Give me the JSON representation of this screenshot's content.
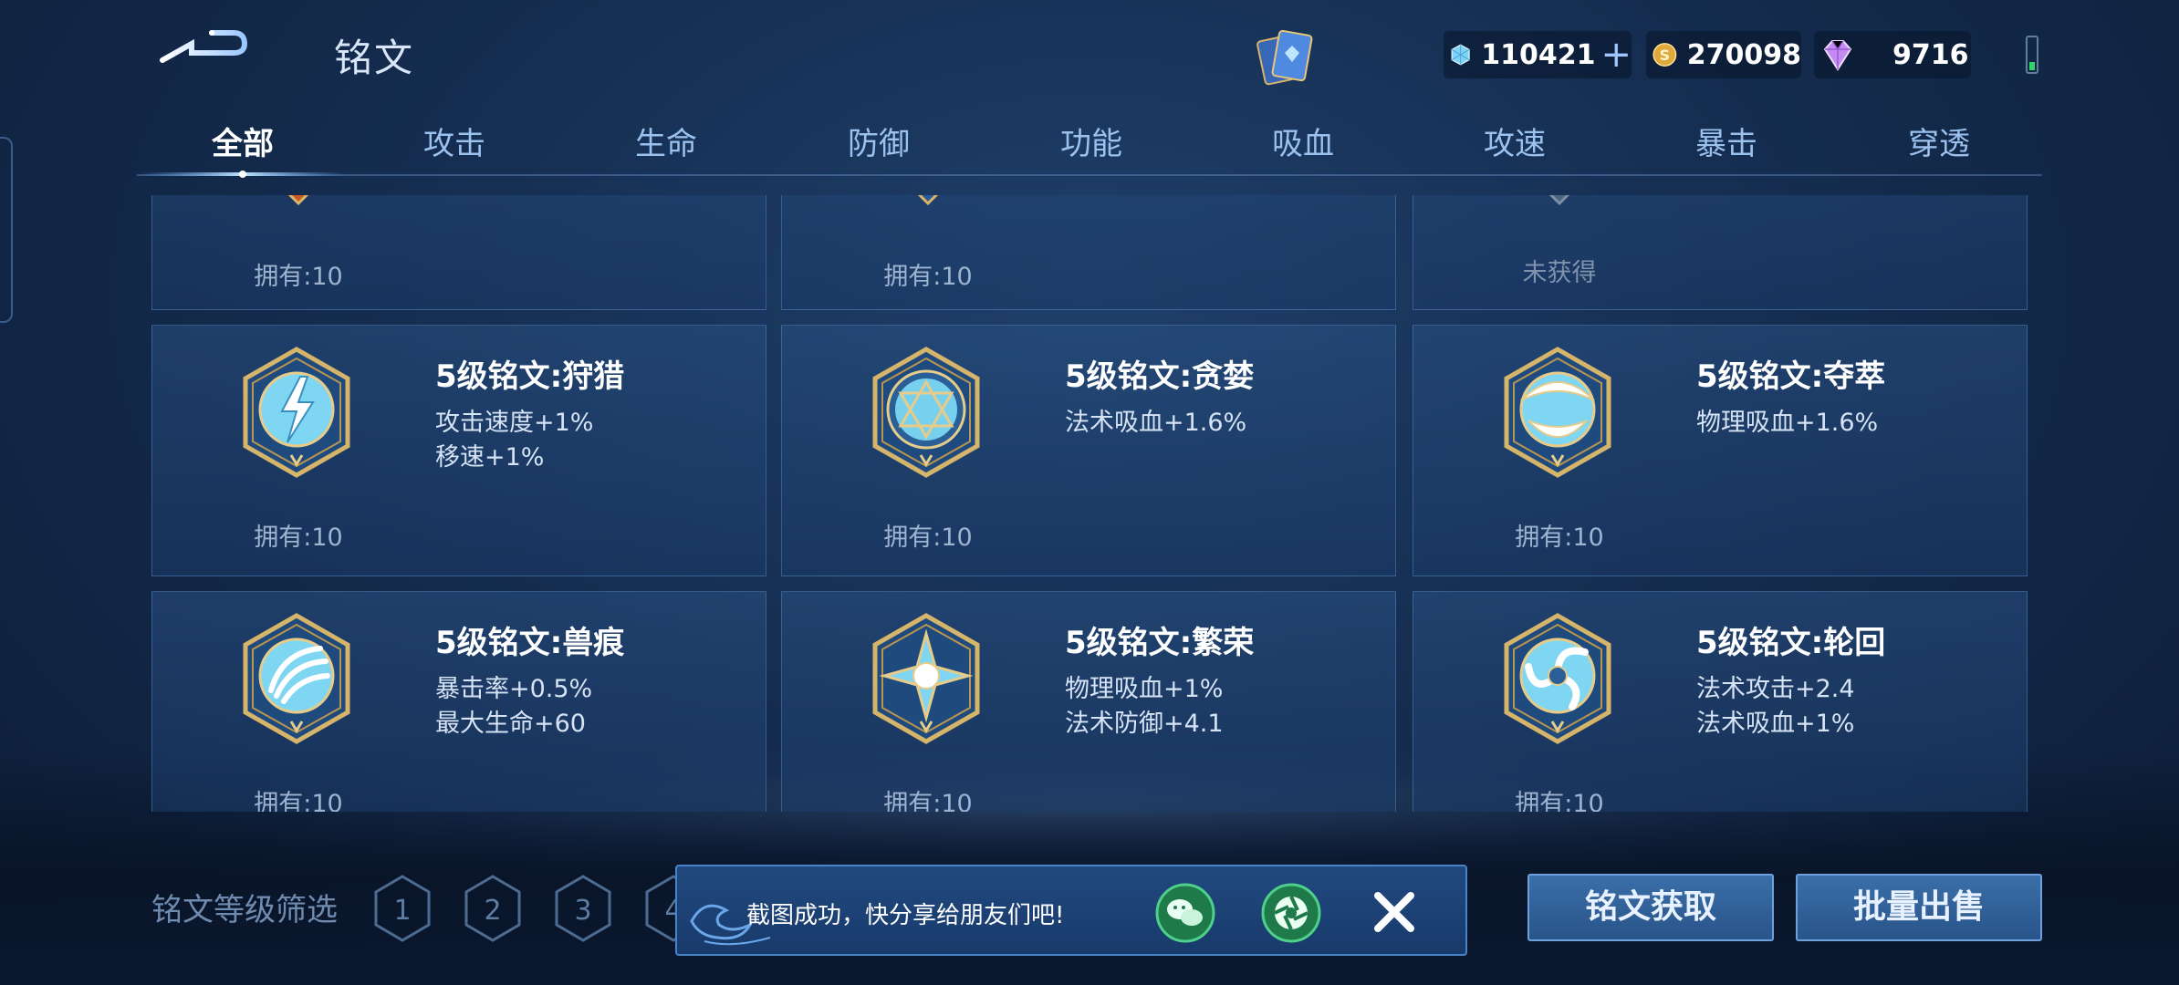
{
  "header": {
    "title": "铭文",
    "currencies": [
      {
        "icon": "crystal-icon",
        "value": "110421",
        "has_add": true
      },
      {
        "icon": "gold-coin-icon",
        "value": "270098",
        "has_add": false
      },
      {
        "icon": "diamond-icon",
        "value": "9716",
        "has_add": false
      }
    ],
    "add_symbol": "+"
  },
  "tabs": [
    "全部",
    "攻击",
    "生命",
    "防御",
    "功能",
    "吸血",
    "攻速",
    "暴击",
    "穿透"
  ],
  "active_tab": 0,
  "partial_row": [
    {
      "owned": "拥有:10"
    },
    {
      "owned": "拥有:10"
    },
    {
      "owned": "未获得"
    }
  ],
  "runes": [
    {
      "name": "5级铭文:狩猎",
      "attrs": [
        "攻击速度+1%",
        "移速+1%"
      ],
      "owned": "拥有:10",
      "icon": "hunt-rune-icon"
    },
    {
      "name": "5级铭文:贪婪",
      "attrs": [
        "法术吸血+1.6%",
        ""
      ],
      "owned": "拥有:10",
      "icon": "greed-rune-icon"
    },
    {
      "name": "5级铭文:夺萃",
      "attrs": [
        "物理吸血+1.6%",
        ""
      ],
      "owned": "拥有:10",
      "icon": "extract-rune-icon"
    },
    {
      "name": "5级铭文:兽痕",
      "attrs": [
        "暴击率+0.5%",
        "最大生命+60"
      ],
      "owned": "拥有:10",
      "icon": "beast-mark-rune-icon"
    },
    {
      "name": "5级铭文:繁荣",
      "attrs": [
        "物理吸血+1%",
        "法术防御+4.1"
      ],
      "owned": "拥有:10",
      "icon": "prosperity-rune-icon"
    },
    {
      "name": "5级铭文:轮回",
      "attrs": [
        "法术攻击+2.4",
        "法术吸血+1%"
      ],
      "owned": "拥有:10",
      "icon": "reincarnation-rune-icon"
    }
  ],
  "bottom": {
    "filter_label": "铭文等级筛选",
    "levels": [
      "1",
      "2",
      "3",
      "4"
    ],
    "toast_text": "截图成功，快分享给朋友们吧!",
    "close_symbol": "✕",
    "obtain_label": "铭文获取",
    "sell_label": "批量出售"
  }
}
